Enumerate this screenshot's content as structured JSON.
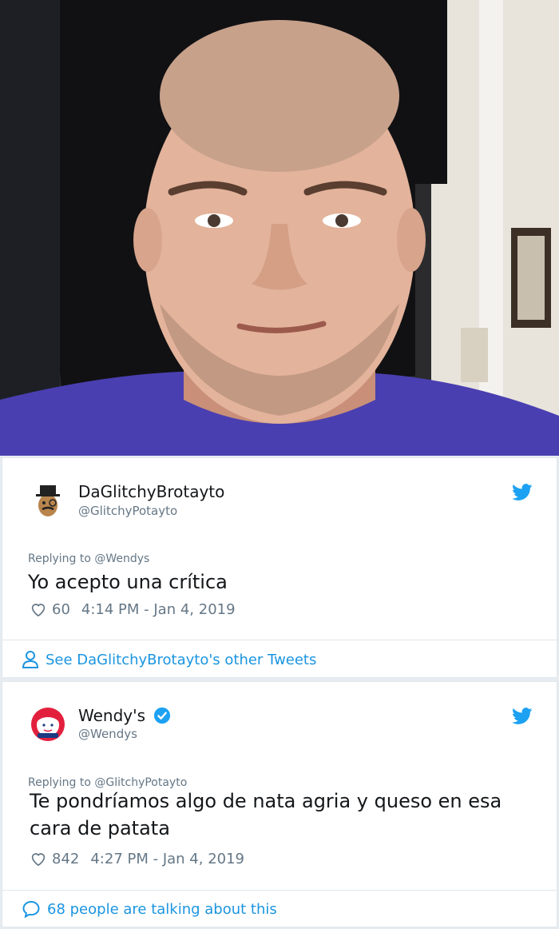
{
  "photo": {
    "alt_icon": "person-selfie-photo"
  },
  "tweet1": {
    "display_name": "DaGlitchyBrotayto",
    "handle": "@GlitchyPotayto",
    "replying_to": "Replying to @Wendys",
    "text": "Yo acepto una crítica",
    "likes": "60",
    "timestamp": "4:14 PM - Jan 4, 2019",
    "footer_link": "See DaGlitchyBrotayto's other Tweets"
  },
  "tweet2": {
    "display_name": "Wendy's",
    "handle": "@Wendys",
    "replying_to": "Replying to @GlitchyPotayto",
    "text_line1": "Te pondríamos algo de nata agria y queso en esa",
    "text_line2": "cara de patata",
    "likes": "842",
    "timestamp": "4:27 PM - Jan 4, 2019",
    "footer_link": "68 people are talking about this"
  },
  "colors": {
    "link": "#1b95e0",
    "muted": "#657786",
    "twitter_blue": "#1da1f2"
  }
}
